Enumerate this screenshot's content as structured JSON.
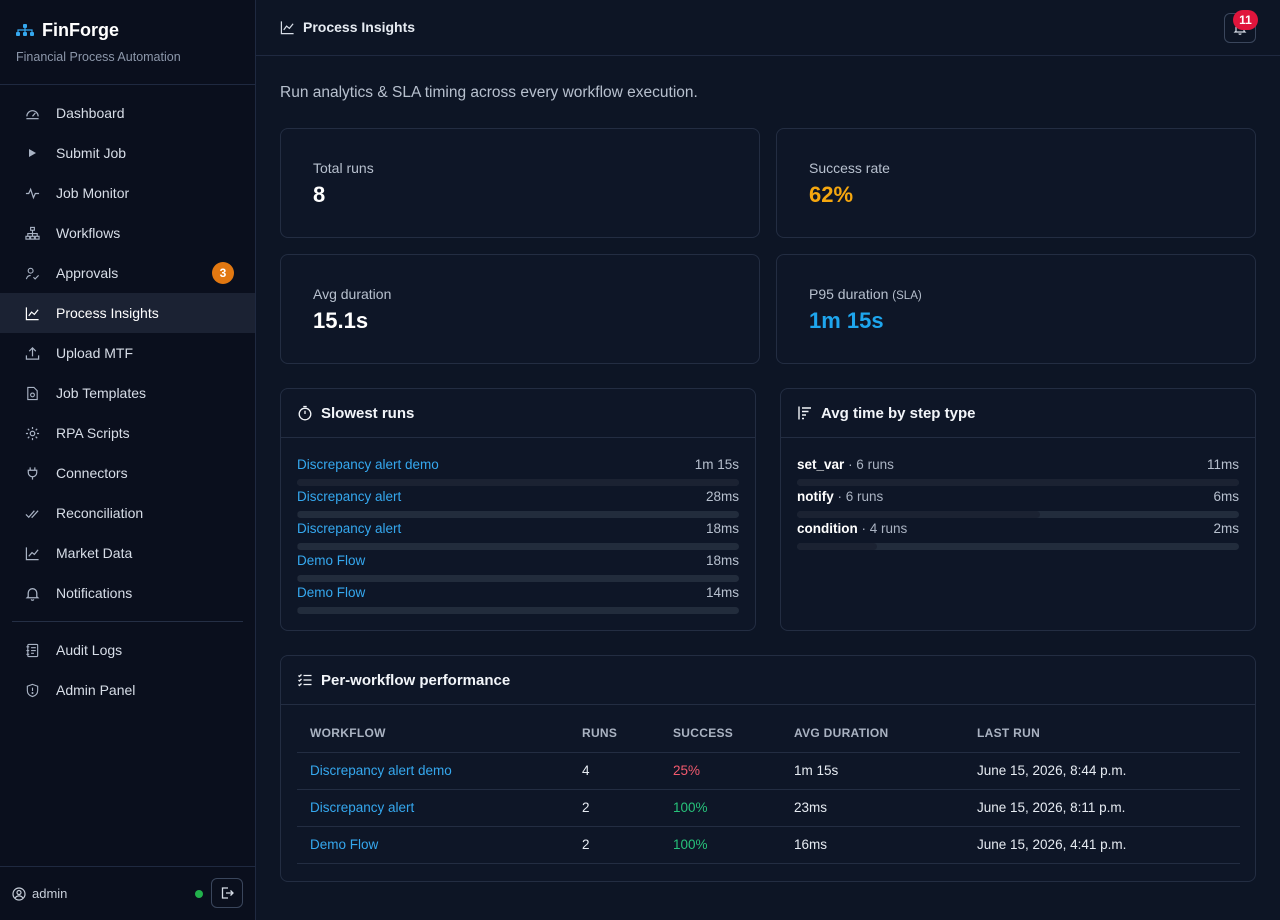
{
  "brand": {
    "name": "FinForge",
    "tagline": "Financial Process Automation",
    "icon": "org-chart-icon"
  },
  "nav": [
    {
      "id": "dashboard",
      "label": "Dashboard",
      "icon": "gauge-icon"
    },
    {
      "id": "submit-job",
      "label": "Submit Job",
      "icon": "play-icon"
    },
    {
      "id": "job-monitor",
      "label": "Job Monitor",
      "icon": "pulse-icon"
    },
    {
      "id": "workflows",
      "label": "Workflows",
      "icon": "hierarchy-icon"
    },
    {
      "id": "approvals",
      "label": "Approvals",
      "icon": "user-check-icon",
      "badge": "3"
    },
    {
      "id": "process-insights",
      "label": "Process Insights",
      "icon": "line-chart-icon",
      "active": true
    },
    {
      "id": "upload-mtf",
      "label": "Upload MTF",
      "icon": "upload-icon"
    },
    {
      "id": "job-templates",
      "label": "Job Templates",
      "icon": "file-gear-icon"
    },
    {
      "id": "rpa-scripts",
      "label": "RPA Scripts",
      "icon": "gear-icon"
    },
    {
      "id": "connectors",
      "label": "Connectors",
      "icon": "plug-icon"
    },
    {
      "id": "reconciliation",
      "label": "Reconciliation",
      "icon": "double-check-icon"
    },
    {
      "id": "market-data",
      "label": "Market Data",
      "icon": "graph-up-icon"
    },
    {
      "id": "notifications",
      "label": "Notifications",
      "icon": "bell-icon"
    },
    {
      "id": "audit-logs",
      "label": "Audit Logs",
      "icon": "journal-icon"
    },
    {
      "id": "admin-panel",
      "label": "Admin Panel",
      "icon": "shield-icon"
    }
  ],
  "user": {
    "name": "admin",
    "status_color": "#22b14c"
  },
  "header": {
    "title": "Process Insights",
    "notification_count": "11"
  },
  "page": {
    "subtitle": "Run analytics & SLA timing across every workflow execution."
  },
  "stats": {
    "total_runs": {
      "label": "Total runs",
      "value": "8"
    },
    "success_rate": {
      "label": "Success rate",
      "value": "62%",
      "color": "#f5a70f"
    },
    "avg_duration": {
      "label": "Avg duration",
      "value": "15.1s"
    },
    "p95_duration": {
      "label": "P95 duration",
      "label_note": "(SLA)",
      "value": "1m 15s",
      "color": "#1ea6ee"
    }
  },
  "slowest_runs": {
    "title": "Slowest runs",
    "items": [
      {
        "name": "Discrepancy alert demo",
        "duration": "1m 15s",
        "fraction": 1.0
      },
      {
        "name": "Discrepancy alert",
        "duration": "28ms",
        "fraction": 0.0004
      },
      {
        "name": "Discrepancy alert",
        "duration": "18ms",
        "fraction": 0.0002
      },
      {
        "name": "Demo Flow",
        "duration": "18ms",
        "fraction": 0.0002
      },
      {
        "name": "Demo Flow",
        "duration": "14ms",
        "fraction": 0.0002
      }
    ]
  },
  "step_types": {
    "title": "Avg time by step type",
    "items": [
      {
        "name": "set_var",
        "runs": "· 6 runs",
        "duration": "11ms",
        "fraction": 1.0
      },
      {
        "name": "notify",
        "runs": "· 6 runs",
        "duration": "6ms",
        "fraction": 0.55
      },
      {
        "name": "condition",
        "runs": "· 4 runs",
        "duration": "2ms",
        "fraction": 0.18
      }
    ]
  },
  "per_workflow": {
    "title": "Per-workflow performance",
    "columns": [
      "WORKFLOW",
      "RUNS",
      "SUCCESS",
      "AVG DURATION",
      "LAST RUN"
    ],
    "rows": [
      {
        "workflow": "Discrepancy alert demo",
        "runs": "4",
        "success": "25%",
        "success_color": "#f25a6e",
        "avg": "1m 15s",
        "last_run": "June 15, 2026, 8:44 p.m."
      },
      {
        "workflow": "Discrepancy alert",
        "runs": "2",
        "success": "100%",
        "success_color": "#27c27a",
        "avg": "23ms",
        "last_run": "June 15, 2026, 8:11 p.m."
      },
      {
        "workflow": "Demo Flow",
        "runs": "2",
        "success": "100%",
        "success_color": "#27c27a",
        "avg": "16ms",
        "last_run": "June 15, 2026, 4:41 p.m."
      }
    ]
  },
  "colors": {
    "accent": "#35a8ef",
    "bar_track": "#222c3c",
    "bar_fill": "#1b2232"
  }
}
